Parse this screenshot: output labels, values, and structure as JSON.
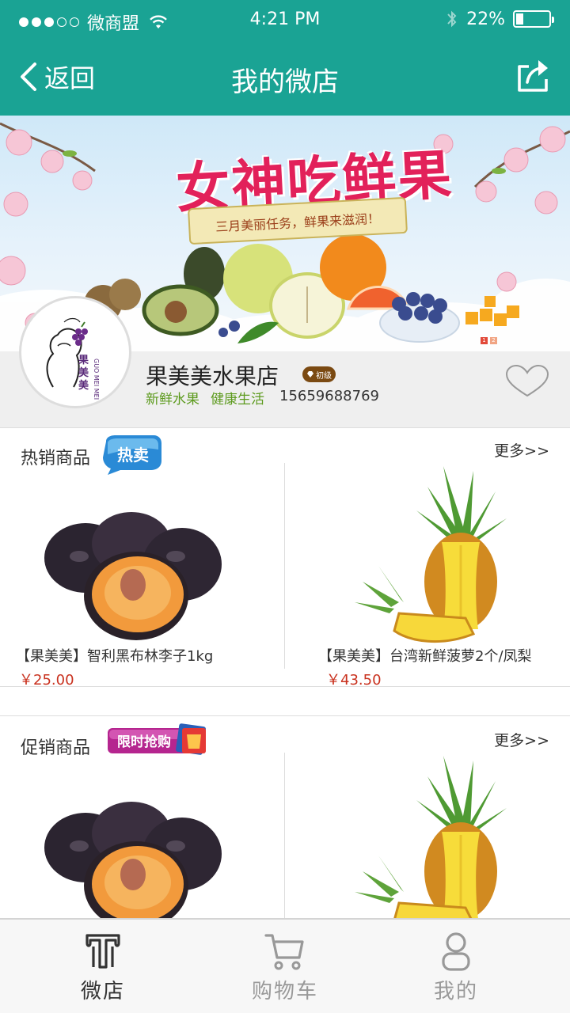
{
  "status_bar": {
    "carrier": "微商盟",
    "time": "4:21 PM",
    "battery": "22%",
    "battery_level": 0.22
  },
  "nav": {
    "back_label": "返回",
    "title": "我的微店",
    "share_icon": "share-icon"
  },
  "banner": {
    "headline": "女神吃鲜果",
    "subline": "三月美丽任务，鲜果来滋润！",
    "pages": [
      "1",
      "2"
    ],
    "active_page": 1
  },
  "shop": {
    "logo_text": "果美美",
    "logo_pinyin": "GUO MEI MEI",
    "name": "果美美水果店",
    "level_badge": "初级",
    "tags": [
      "新鲜水果",
      "健康生活"
    ],
    "phone": "15659688769",
    "favorite_icon": "heart-outline-icon"
  },
  "hot_section": {
    "title": "热销商品",
    "tag": "热卖",
    "more": "更多>>",
    "products": [
      {
        "name": "【果美美】智利黑布林李子1kg",
        "price": "￥25.00",
        "image": "plum"
      },
      {
        "name": "【果美美】台湾新鲜菠萝2个/凤梨",
        "price": "￥43.50",
        "image": "pineapple"
      }
    ]
  },
  "promo_section": {
    "title": "促销商品",
    "tag": "限时抢购",
    "more": "更多>>",
    "products": [
      {
        "image": "plum"
      },
      {
        "image": "pineapple"
      }
    ]
  },
  "tabbar": {
    "items": [
      {
        "label": "微店",
        "icon": "shop-icon",
        "active": true
      },
      {
        "label": "购物车",
        "icon": "cart-icon",
        "active": false
      },
      {
        "label": "我的",
        "icon": "person-icon",
        "active": false
      }
    ]
  },
  "colors": {
    "header": "#1aa394",
    "price": "#c9311e",
    "tag_green": "#5c9a1d",
    "banner_title": "#e2215a"
  }
}
